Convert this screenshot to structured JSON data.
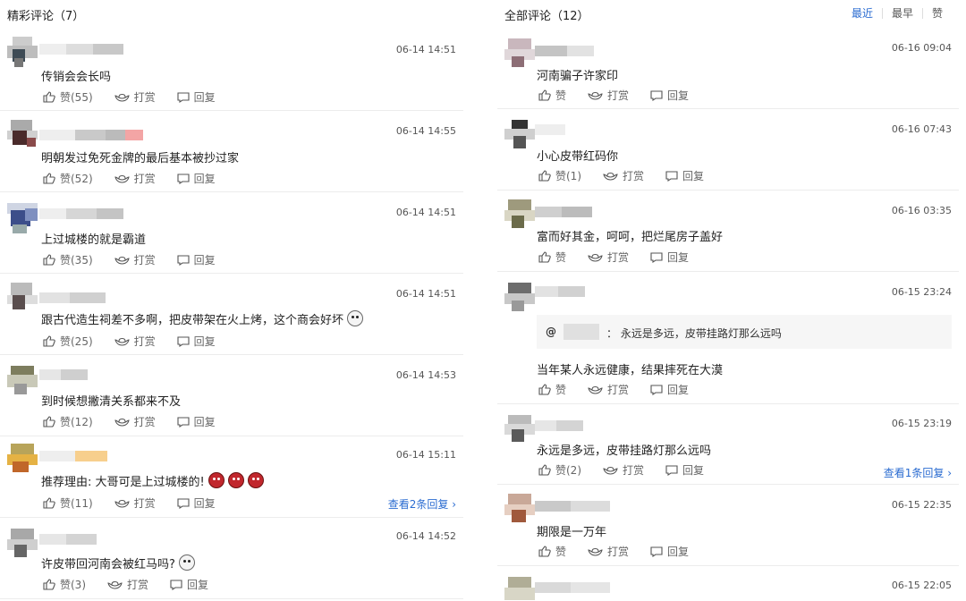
{
  "left": {
    "title": "精彩评论（7）",
    "comments": [
      {
        "time": "06-14 14:51",
        "text": "传销会会长吗",
        "like": "赞(55)",
        "reward": "打赏",
        "reply": "回复",
        "more": ""
      },
      {
        "time": "06-14 14:55",
        "text": "明朝发过免死金牌的最后基本被抄过家",
        "like": "赞(52)",
        "reward": "打赏",
        "reply": "回复",
        "more": ""
      },
      {
        "time": "06-14 14:51",
        "text": "上过城楼的就是霸道",
        "like": "赞(35)",
        "reward": "打赏",
        "reply": "回复",
        "more": ""
      },
      {
        "time": "06-14 14:51",
        "text": "跟古代造生祠差不多啊，把皮带架在火上烤，这个商会好坏",
        "like": "赞(25)",
        "reward": "打赏",
        "reply": "回复",
        "more": ""
      },
      {
        "time": "06-14 14:53",
        "text": "到时候想撇清关系都来不及",
        "like": "赞(12)",
        "reward": "打赏",
        "reply": "回复",
        "more": ""
      },
      {
        "time": "06-14 15:11",
        "text": "推荐理由: 大哥可是上过城楼的!",
        "like": "赞(11)",
        "reward": "打赏",
        "reply": "回复",
        "more": "查看2条回复 ›"
      },
      {
        "time": "06-14 14:52",
        "text": "许皮带回河南会被红马吗?",
        "like": "赞(3)",
        "reward": "打赏",
        "reply": "回复",
        "more": ""
      }
    ]
  },
  "right": {
    "title": "全部评论（12）",
    "sort": {
      "latest": "最近",
      "earliest": "最早",
      "likes": "赞"
    },
    "comments": [
      {
        "time": "06-16 09:04",
        "text": "河南骗子许家印",
        "like": "赞",
        "reward": "打赏",
        "reply": "回复",
        "more": ""
      },
      {
        "time": "06-16 07:43",
        "text": "小心皮带红码你",
        "like": "赞(1)",
        "reward": "打赏",
        "reply": "回复",
        "more": ""
      },
      {
        "time": "06-16 03:35",
        "text": "富而好其金，呵呵，把烂尾房子盖好",
        "like": "赞",
        "reward": "打赏",
        "reply": "回复",
        "more": ""
      },
      {
        "time": "06-15 23:24",
        "quote_who": "@",
        "quote_text": "：  永远是多远，皮带挂路灯那么远吗",
        "text": "当年某人永远健康，结果摔死在大漠",
        "like": "赞",
        "reward": "打赏",
        "reply": "回复",
        "more": ""
      },
      {
        "time": "06-15 23:19",
        "text": "永远是多远，皮带挂路灯那么远吗",
        "like": "赞(2)",
        "reward": "打赏",
        "reply": "回复",
        "more": "查看1条回复 ›"
      },
      {
        "time": "06-15 22:35",
        "text": "期限是一万年",
        "like": "赞",
        "reward": "打赏",
        "reply": "回复",
        "more": ""
      },
      {
        "time": "06-15 22:05",
        "text": "",
        "like": "",
        "reward": "",
        "reply": "",
        "more": ""
      }
    ]
  }
}
